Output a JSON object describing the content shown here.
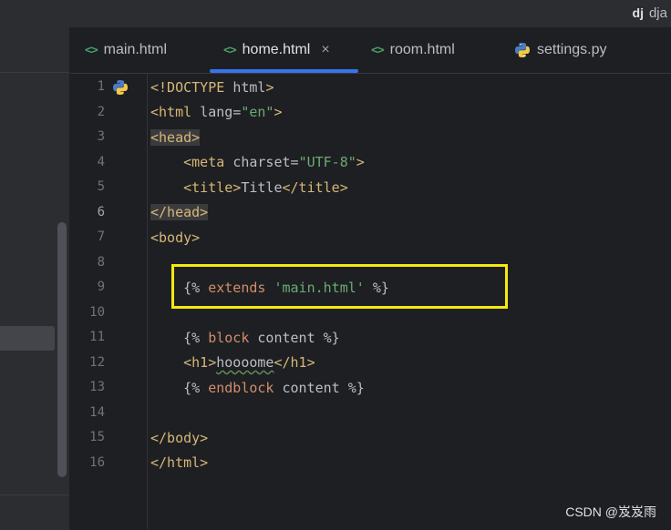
{
  "window": {
    "project_logo": "dj",
    "project_name": "dja"
  },
  "tabs": [
    {
      "label": "main.html",
      "icon": "<>"
    },
    {
      "label": "home.html",
      "icon": "<>",
      "close": "×"
    },
    {
      "label": "room.html",
      "icon": "<>"
    },
    {
      "label": "settings.py",
      "icon": "python-icon"
    }
  ],
  "active_tab": "home.html",
  "current_line": 6,
  "line_numbers": [
    "1",
    "2",
    "3",
    "4",
    "5",
    "6",
    "7",
    "8",
    "9",
    "10",
    "11",
    "12",
    "13",
    "14",
    "15",
    "16"
  ],
  "code": {
    "l1": {
      "a": "<!DOCTYPE ",
      "b": "html",
      "c": ">"
    },
    "l2": {
      "a": "<html ",
      "b": "lang",
      "c": "=",
      "d": "\"en\"",
      "e": ">"
    },
    "l3": {
      "a": "<head>"
    },
    "l4": {
      "indent": "    ",
      "a": "<meta ",
      "b": "charset",
      "c": "=",
      "d": "\"UTF-8\"",
      "e": ">"
    },
    "l5": {
      "indent": "    ",
      "a": "<title>",
      "b": "Title",
      "c": "</title>"
    },
    "l6": {
      "a": "</head>"
    },
    "l7": {
      "a": "<body>"
    },
    "l9": {
      "indent": "    ",
      "a": "{% ",
      "b": "extends",
      "c": " ",
      "d": "'main.html'",
      "e": " %}"
    },
    "l11": {
      "indent": "    ",
      "a": "{% ",
      "b": "block",
      "c": " content %}"
    },
    "l12": {
      "indent": "    ",
      "a": "<h1>",
      "b": "hoooome",
      "c": "</h1>"
    },
    "l13": {
      "indent": "    ",
      "a": "{% ",
      "b": "endblock",
      "c": " content %}"
    },
    "l15": {
      "a": "</body>"
    },
    "l16": {
      "a": "</html>"
    }
  },
  "watermark": "CSDN @岌岌雨",
  "colors": {
    "accent": "#3574f0",
    "highlight_box": "#f5e90f",
    "tag": "#d5b778",
    "string": "#6aab73",
    "keyword": "#cf8e6d"
  }
}
